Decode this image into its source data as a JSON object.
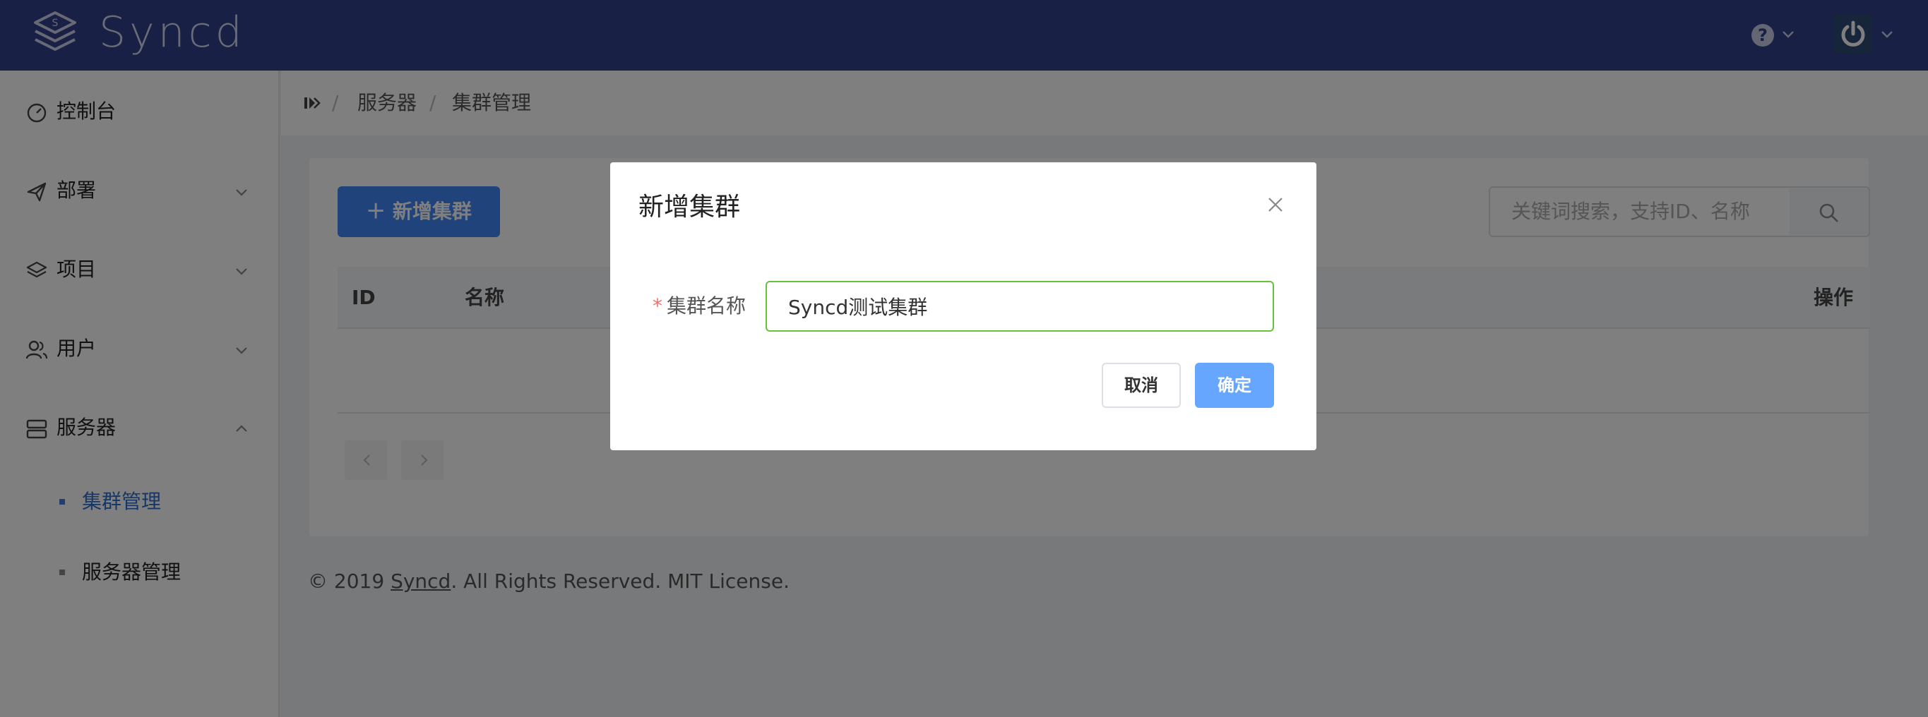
{
  "header": {
    "brand": "Syncd",
    "help_glyph": "?",
    "icons": [
      "layers-logo-icon",
      "help-icon",
      "chevron-down-icon",
      "power-icon",
      "chevron-down-icon"
    ]
  },
  "sidebar": {
    "items": [
      {
        "label": "控制台",
        "icon": "dashboard-icon"
      },
      {
        "label": "部署",
        "icon": "paper-plane-icon"
      },
      {
        "label": "项目",
        "icon": "layers-icon"
      },
      {
        "label": "用户",
        "icon": "users-icon"
      },
      {
        "label": "服务器",
        "icon": "server-icon"
      }
    ],
    "subitems": [
      {
        "label": "集群管理",
        "active": true
      },
      {
        "label": "服务器管理",
        "active": false
      }
    ]
  },
  "breadcrumb": {
    "items": [
      "服务器",
      "集群管理"
    ],
    "separator": "/"
  },
  "main": {
    "add_button": "＋ 新增集群",
    "search_placeholder": "关键词搜索，支持ID、名称",
    "table": {
      "columns": [
        "ID",
        "名称",
        "操作"
      ]
    }
  },
  "footer": {
    "prefix": "© 2019 ",
    "link": "Syncd",
    "suffix": ". All Rights Reserved. MIT License."
  },
  "modal": {
    "title": "新增集群",
    "field_required": "*",
    "field_label": "集群名称",
    "field_value": "Syncd测试集群",
    "cancel_label": "取消",
    "ok_label": "确定"
  },
  "colors": {
    "header": "#33408a",
    "primary": "#3f87f5",
    "active_menu": "#2d6fcf",
    "input_valid_border": "#67c23a",
    "required": "#f56c6c"
  }
}
